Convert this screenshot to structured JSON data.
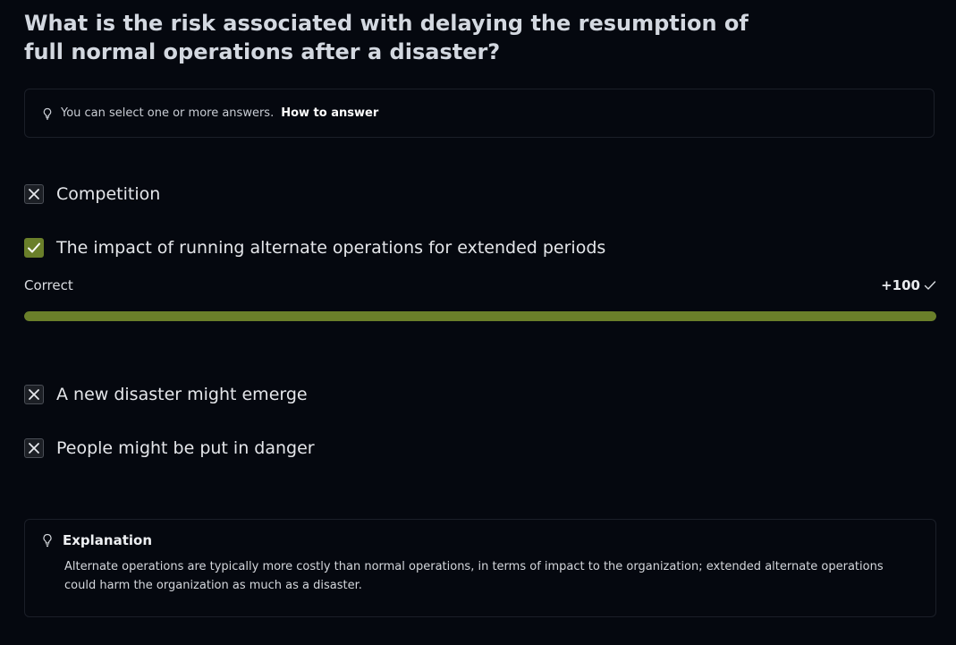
{
  "question": {
    "title": "What is the risk associated with delaying the resumption of full normal operations after a disaster?"
  },
  "hint": {
    "text": "You can select one or more answers.",
    "how_to_answer": "How to answer",
    "icon": "lightbulb-icon"
  },
  "answers": [
    {
      "label": "Competition",
      "state": "incorrect-unselected",
      "icon": "x-icon"
    },
    {
      "label": "The impact of running alternate operations for extended periods",
      "state": "correct-selected",
      "icon": "check-icon"
    },
    {
      "label": "A new disaster might emerge",
      "state": "incorrect-unselected",
      "icon": "x-icon"
    },
    {
      "label": "People might be put in danger",
      "state": "incorrect-unselected",
      "icon": "x-icon"
    }
  ],
  "result": {
    "label": "Correct",
    "score": "+100",
    "progress_percent": 100,
    "color": "#6a7f2a"
  },
  "explanation": {
    "title": "Explanation",
    "text": "Alternate operations are typically more costly than normal operations, in terms of impact to the organization; extended alternate operations could harm the organization as much as a disaster.",
    "icon": "lightbulb-icon"
  }
}
